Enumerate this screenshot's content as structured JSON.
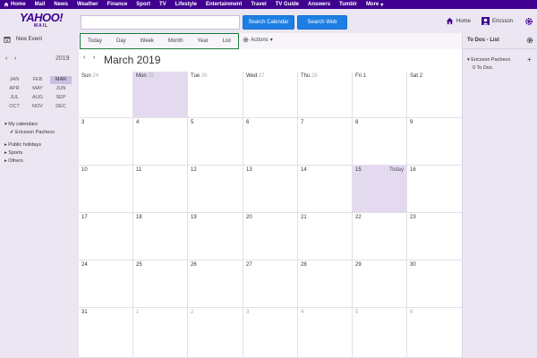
{
  "topnav": [
    {
      "label": "Home",
      "icon": "home-icon"
    },
    {
      "label": "Mail"
    },
    {
      "label": "News"
    },
    {
      "label": "Weather"
    },
    {
      "label": "Finance"
    },
    {
      "label": "Sport"
    },
    {
      "label": "TV"
    },
    {
      "label": "Lifestyle"
    },
    {
      "label": "Entertainment"
    },
    {
      "label": "Travel"
    },
    {
      "label": "TV Guide"
    },
    {
      "label": "Answers"
    },
    {
      "label": "Tumblr"
    },
    {
      "label": "More",
      "icon": "chevron-down-icon"
    }
  ],
  "header": {
    "logo_line1": "YAHOO!",
    "logo_line2": "MAIL",
    "search_value": "",
    "search_calendar": "Search Calendar",
    "search_web": "Search Web",
    "home": "Home",
    "user": "Ericsson"
  },
  "sidebar": {
    "new_event": "New Event",
    "year": "2019",
    "prev": "‹",
    "next": "›",
    "months": [
      "JAN",
      "FEB",
      "MAR",
      "APR",
      "MAY",
      "JUN",
      "JUL",
      "AUG",
      "SEP",
      "OCT",
      "NOV",
      "DEC"
    ],
    "active_month": "MAR",
    "my_calendars": "My calendars",
    "calendar_owner": "Ericsson Pacheco",
    "public_holidays": "Public holidays",
    "sports": "Sports",
    "others": "Others"
  },
  "toolbar": {
    "tabs": [
      "Today",
      "Day",
      "Week",
      "Month",
      "Year",
      "List"
    ],
    "actions": "Actions"
  },
  "calendar": {
    "title": "March 2019",
    "prev": "‹",
    "next": "›",
    "weekdays": [
      "Sun",
      "Mon",
      "Tue",
      "Wed",
      "Thu",
      "Fri",
      "Sat"
    ],
    "today_label": "Today",
    "weeks": [
      [
        [
          "24",
          true
        ],
        [
          "25",
          true
        ],
        [
          "26",
          true
        ],
        [
          "27",
          true
        ],
        [
          "28",
          true
        ],
        [
          "1",
          false
        ],
        [
          "2",
          false
        ]
      ],
      [
        [
          "3",
          false
        ],
        [
          "4",
          false
        ],
        [
          "5",
          false
        ],
        [
          "6",
          false
        ],
        [
          "7",
          false
        ],
        [
          "8",
          false
        ],
        [
          "9",
          false
        ]
      ],
      [
        [
          "10",
          false
        ],
        [
          "11",
          false
        ],
        [
          "12",
          false
        ],
        [
          "13",
          false
        ],
        [
          "14",
          false
        ],
        [
          "15",
          false
        ],
        [
          "16",
          false
        ]
      ],
      [
        [
          "17",
          false
        ],
        [
          "18",
          false
        ],
        [
          "19",
          false
        ],
        [
          "20",
          false
        ],
        [
          "21",
          false
        ],
        [
          "22",
          false
        ],
        [
          "23",
          false
        ]
      ],
      [
        [
          "24",
          false
        ],
        [
          "25",
          false
        ],
        [
          "26",
          false
        ],
        [
          "27",
          false
        ],
        [
          "28",
          false
        ],
        [
          "29",
          false
        ],
        [
          "30",
          false
        ]
      ],
      [
        [
          "31",
          false
        ],
        [
          "1",
          true
        ],
        [
          "2",
          true
        ],
        [
          "3",
          true
        ],
        [
          "4",
          true
        ],
        [
          "5",
          true
        ],
        [
          "6",
          true
        ]
      ]
    ],
    "highlight": [
      [
        0,
        1
      ],
      [
        2,
        5
      ]
    ],
    "today": [
      2,
      5
    ]
  },
  "todo": {
    "title": "To Dos - List",
    "owner": "Ericsson Pacheco",
    "count": "0 To Dos."
  },
  "colors": {
    "nav_bg": "#400090",
    "button": "#1d7fe3",
    "highlight": "#e4daf0",
    "tab_border": "#1a7a3a"
  }
}
